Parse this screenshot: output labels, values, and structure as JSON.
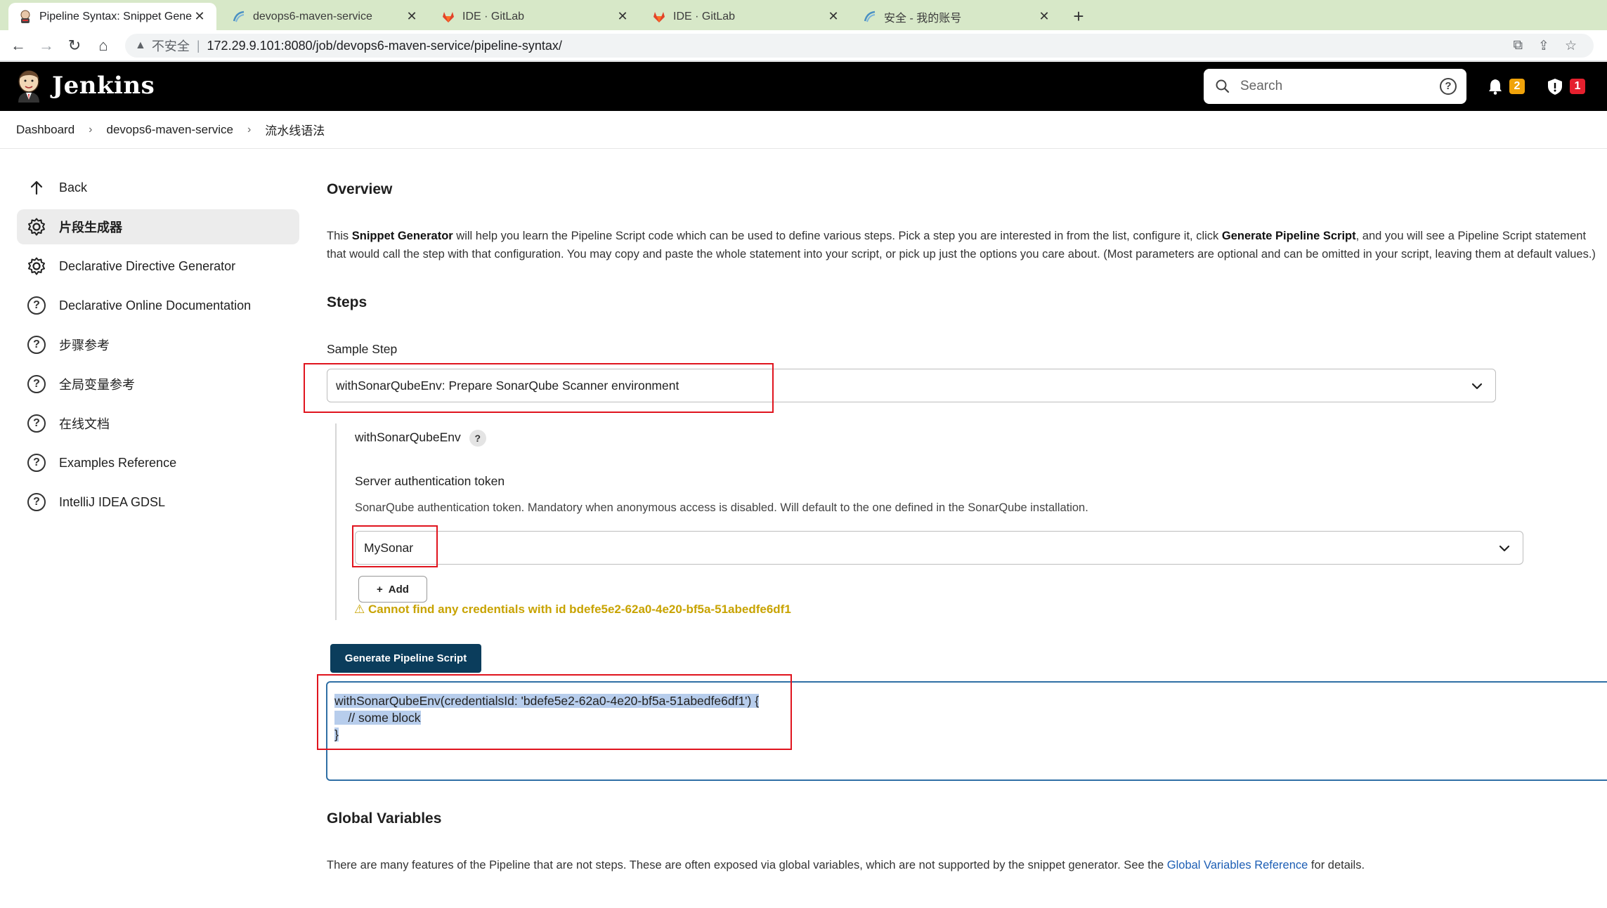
{
  "browser": {
    "tabs": [
      {
        "label": "Pipeline Syntax: Snippet Generator",
        "active": true
      },
      {
        "label": "devops6-maven-service",
        "active": false
      },
      {
        "label": "IDE · GitLab",
        "active": false
      },
      {
        "label": "IDE · GitLab",
        "active": false
      },
      {
        "label": "安全 - 我的账号",
        "active": false
      }
    ],
    "insecure_label": "不安全",
    "url": "172.29.9.101:8080/job/devops6-maven-service/pipeline-syntax/"
  },
  "header": {
    "brand": "Jenkins",
    "search_placeholder": "Search",
    "notifications_count": "2",
    "security_count": "1",
    "colors": {
      "notification_badge": "#f0a30a",
      "security_badge": "#e5202e"
    }
  },
  "breadcrumb": [
    "Dashboard",
    "devops6-maven-service",
    "流水线语法"
  ],
  "sidebar": {
    "items": [
      {
        "label": "Back",
        "icon": "arrow-up-icon"
      },
      {
        "label": "片段生成器",
        "icon": "gear-icon",
        "active": true
      },
      {
        "label": "Declarative Directive Generator",
        "icon": "gear-icon"
      },
      {
        "label": "Declarative Online Documentation",
        "icon": "help-circle-icon"
      },
      {
        "label": "步骤参考",
        "icon": "help-circle-icon"
      },
      {
        "label": "全局变量参考",
        "icon": "help-circle-icon"
      },
      {
        "label": "在线文档",
        "icon": "help-circle-icon"
      },
      {
        "label": "Examples Reference",
        "icon": "help-circle-icon"
      },
      {
        "label": "IntelliJ IDEA GDSL",
        "icon": "help-circle-icon"
      }
    ]
  },
  "overview": {
    "title": "Overview",
    "text_1": "This ",
    "bold_1": "Snippet Generator",
    "text_2": " will help you learn the Pipeline Script code which can be used to define various steps. Pick a step you are interested in from the list, configure it, click ",
    "bold_2": "Generate Pipeline Script",
    "text_3": ", and you will see a Pipeline Script statement that would call the step with that configuration. You may copy and paste the whole statement into your script, or pick up just the options you care about. (Most parameters are optional and can be omitted in your script, leaving them at default values.)"
  },
  "steps": {
    "title": "Steps",
    "sample_step_label": "Sample Step",
    "sample_step_value": "withSonarQubeEnv: Prepare SonarQube Scanner environment",
    "step_name": "withSonarQubeEnv",
    "help_mark": "?",
    "token_label": "Server authentication token",
    "token_description": "SonarQube authentication token. Mandatory when anonymous access is disabled. Will default to the one defined in the SonarQube installation.",
    "token_value": "MySonar",
    "add_button": "Add",
    "add_symbol": "+",
    "warning_symbol": "⚠",
    "warning": "Cannot find any credentials with id bdefe5e2-62a0-4e20-bf5a-51abedfe6df1",
    "generate_button": "Generate Pipeline Script",
    "script_line_1": "withSonarQubeEnv(credentialsId: 'bdefe5e2-62a0-4e20-bf5a-51abedfe6df1') {",
    "script_line_2": "    // some block",
    "script_line_3": "}"
  },
  "global_variables": {
    "title": "Global Variables",
    "text_1": "There are many features of the Pipeline that are not steps. These are often exposed via global variables, which are not supported by the snippet generator. See the ",
    "link": "Global Variables Reference",
    "text_2": " for details."
  }
}
